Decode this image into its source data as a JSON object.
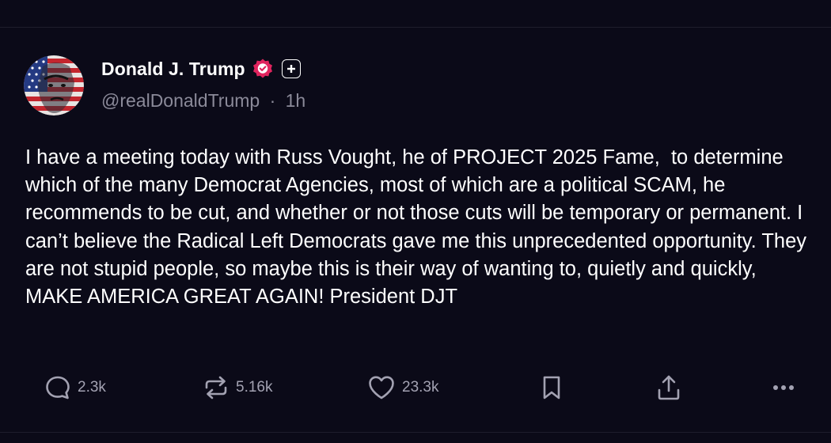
{
  "author": {
    "display_name": "Donald J. Trump",
    "handle": "@realDonaldTrump",
    "separator": "·",
    "time": "1h",
    "verified_icon": "verified-badge-icon",
    "plus_icon": "plus-badge-icon"
  },
  "post": {
    "text": "I have a meeting today with Russ Vought, he of PROJECT 2025 Fame,  to determine which of the many Democrat Agencies, most of which are a political SCAM, he recommends to be cut, and whether or not those cuts will be temporary or permanent. I can’t believe the Radical Left Democrats gave me this unprecedented opportunity. They are not stupid people, so maybe this is their way of wanting to, quietly and quickly, MAKE AMERICA GREAT AGAIN! President DJT"
  },
  "actions": {
    "replies": "2.3k",
    "reposts": "5.16k",
    "likes": "23.3k",
    "icons": [
      "reply-icon",
      "repost-icon",
      "like-icon",
      "bookmark-icon",
      "share-icon",
      "more-icon"
    ]
  },
  "colors": {
    "background": "#0b0a18",
    "text": "#ffffff",
    "muted": "#8b8a99",
    "verified": "#e0245e"
  }
}
